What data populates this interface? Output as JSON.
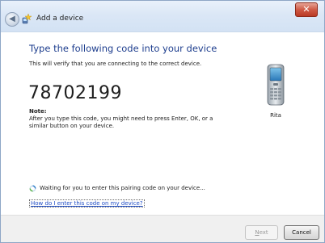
{
  "window": {
    "title": "Add a device",
    "close_glyph": "✕",
    "back_glyph": "◀"
  },
  "main": {
    "heading": "Type the following code into your device",
    "subtext": "This will verify that you are connecting to the correct device.",
    "pairing_code": "78702199",
    "note_label": "Note:",
    "note_text": "After you type this code, you might need to press Enter, OK, or a similar button on your device.",
    "device_name": "Rita",
    "device_icon": "phone-icon"
  },
  "status": {
    "text": "Waiting for you to enter this pairing code on your device...",
    "icon": "spinner-icon"
  },
  "help_link": "How do I enter this code on my device?",
  "footer": {
    "next_mnemonic": "N",
    "next_rest": "ext",
    "cancel_label": "Cancel"
  },
  "colors": {
    "heading": "#1e3e8e",
    "link": "#1e4cc4",
    "close_button": "#c74a35"
  }
}
